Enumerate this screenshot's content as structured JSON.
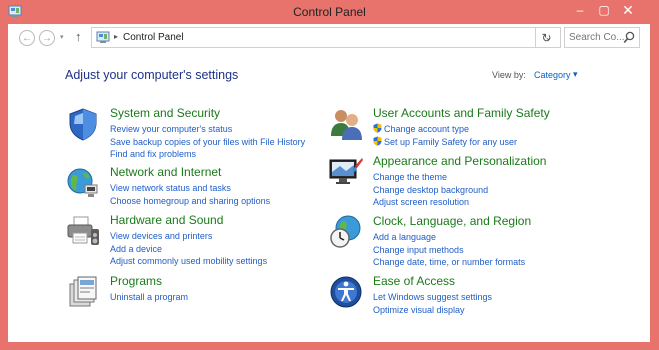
{
  "window": {
    "title": "Control Panel",
    "minimize_symbol": "–",
    "maximize_symbol": "▢",
    "close_symbol": "✕"
  },
  "navigation": {
    "back_symbol": "←",
    "forward_symbol": "→",
    "recent_symbol": "▾",
    "up_symbol": "↑",
    "address_separator": "▸",
    "address_text": "Control Panel",
    "address_dropdown_symbol": "⌄",
    "refresh_symbol": "↻",
    "search_placeholder": "Search Co..."
  },
  "main": {
    "heading": "Adjust your computer's settings",
    "view_by_label": "View by:",
    "view_by_value": "Category",
    "view_by_arrow": "▾"
  },
  "categories": [
    {
      "title": "System and Security",
      "icon": "shield-icon",
      "links": [
        {
          "label": "Review your computer's status"
        },
        {
          "label": "Save backup copies of your files with File History"
        },
        {
          "label": "Find and fix problems"
        }
      ]
    },
    {
      "title": "Network and Internet",
      "icon": "globe-network-icon",
      "links": [
        {
          "label": "View network status and tasks"
        },
        {
          "label": "Choose homegroup and sharing options"
        }
      ]
    },
    {
      "title": "Hardware and Sound",
      "icon": "printer-icon",
      "links": [
        {
          "label": "View devices and printers"
        },
        {
          "label": "Add a device"
        },
        {
          "label": "Adjust commonly used mobility settings"
        }
      ]
    },
    {
      "title": "Programs",
      "icon": "programs-icon",
      "links": [
        {
          "label": "Uninstall a program"
        }
      ]
    },
    {
      "title": "User Accounts and Family Safety",
      "icon": "users-icon",
      "links": [
        {
          "label": "Change account type",
          "shield": true
        },
        {
          "label": "Set up Family Safety for any user",
          "shield": true
        }
      ]
    },
    {
      "title": "Appearance and Personalization",
      "icon": "monitor-paint-icon",
      "links": [
        {
          "label": "Change the theme"
        },
        {
          "label": "Change desktop background"
        },
        {
          "label": "Adjust screen resolution"
        }
      ]
    },
    {
      "title": "Clock, Language, and Region",
      "icon": "clock-globe-icon",
      "links": [
        {
          "label": "Add a language"
        },
        {
          "label": "Change input methods"
        },
        {
          "label": "Change date, time, or number formats"
        }
      ]
    },
    {
      "title": "Ease of Access",
      "icon": "ease-of-access-icon",
      "links": [
        {
          "label": "Let Windows suggest settings"
        },
        {
          "label": "Optimize visual display"
        }
      ]
    }
  ]
}
